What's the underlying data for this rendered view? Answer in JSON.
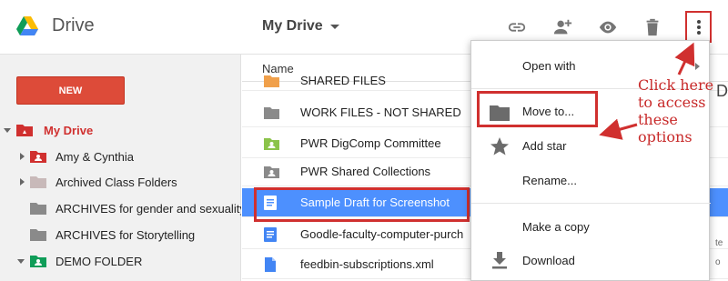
{
  "header": {
    "app_title": "Drive",
    "breadcrumb": "My Drive",
    "toolbar_icons": [
      "link-icon",
      "add-person-icon",
      "preview-eye-icon",
      "trash-icon",
      "more-vert-icon"
    ]
  },
  "sidebar": {
    "new_label": "NEW",
    "items": [
      {
        "label": "My Drive",
        "icon": "drive-folder-icon",
        "color": "#d0302f"
      },
      {
        "label": "Amy & Cynthia",
        "icon": "shared-folder-icon",
        "color": "#d0302f"
      },
      {
        "label": "Archived Class Folders",
        "icon": "folder-icon",
        "color": "#c8b9b9"
      },
      {
        "label": "ARCHIVES for gender and sexuality",
        "icon": "folder-icon",
        "color": "#8a8a8a"
      },
      {
        "label": "ARCHIVES for Storytelling",
        "icon": "folder-icon",
        "color": "#8a8a8a"
      },
      {
        "label": "DEMO FOLDER",
        "icon": "shared-folder-icon",
        "color": "#0f9d58"
      }
    ]
  },
  "filelist": {
    "column_name": "Name",
    "rows": [
      {
        "label": "SHARED FILES",
        "icon": "folder-icon"
      },
      {
        "label": "WORK FILES - NOT SHARED",
        "icon": "folder-icon"
      },
      {
        "label": "PWR DigComp Committee",
        "icon": "shared-folder-icon"
      },
      {
        "label": "PWR Shared Collections",
        "icon": "shared-folder-icon"
      },
      {
        "label": "Sample Draft for Screenshot",
        "icon": "doc-icon"
      },
      {
        "label": "Goodle-faculty-computer-purch",
        "icon": "doc-icon"
      },
      {
        "label": "feedbin-subscriptions.xml",
        "icon": "file-icon"
      }
    ],
    "peek_d": "D",
    "peek_text_1": "te",
    "peek_text_2": "o"
  },
  "context_menu": {
    "items": [
      {
        "label": "Open with",
        "icon": "",
        "has_submenu": true
      },
      {
        "label": "Move to...",
        "icon": "folder-icon"
      },
      {
        "label": "Add star",
        "icon": "star-icon"
      },
      {
        "label": "Rename...",
        "icon": ""
      },
      {
        "label": "Make a copy",
        "icon": ""
      },
      {
        "label": "Download",
        "icon": "download-icon"
      }
    ]
  },
  "annotation": {
    "lines": [
      "Click here",
      "to access",
      "these",
      "options"
    ],
    "color": "#c82a2a"
  },
  "colors": {
    "accent_red": "#d0302f",
    "selection_blue": "#4d90fe",
    "new_button": "#dd4b39"
  }
}
